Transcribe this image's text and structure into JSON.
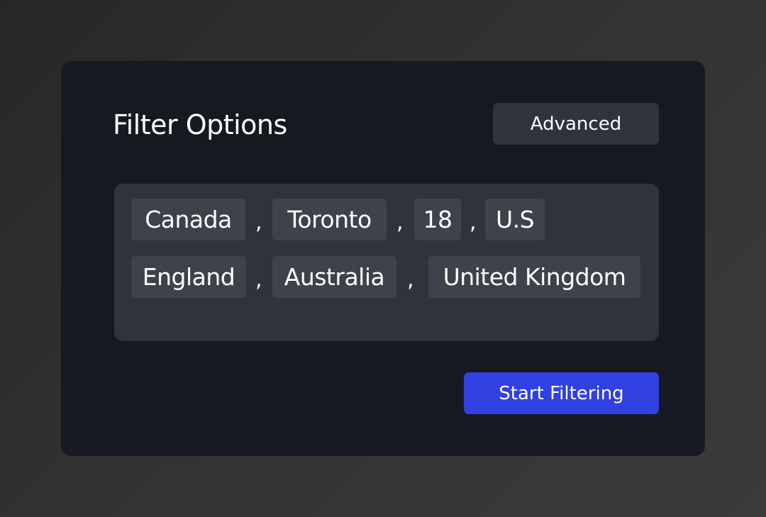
{
  "card": {
    "title": "Filter Options",
    "advanced_label": "Advanced",
    "start_label": "Start Filtering"
  },
  "tags": [
    {
      "label": "Canada"
    },
    {
      "label": "Toronto"
    },
    {
      "label": "18"
    },
    {
      "label": "U.S"
    },
    {
      "label": "England"
    },
    {
      "label": "Australia"
    },
    {
      "label": "United Kingdom"
    }
  ],
  "separator": ",",
  "colors": {
    "card_background": "#161920",
    "tag_box_background": "#30333b",
    "tag_background": "#3f424a",
    "primary_button": "#3140e0",
    "text": "#ffffff"
  }
}
